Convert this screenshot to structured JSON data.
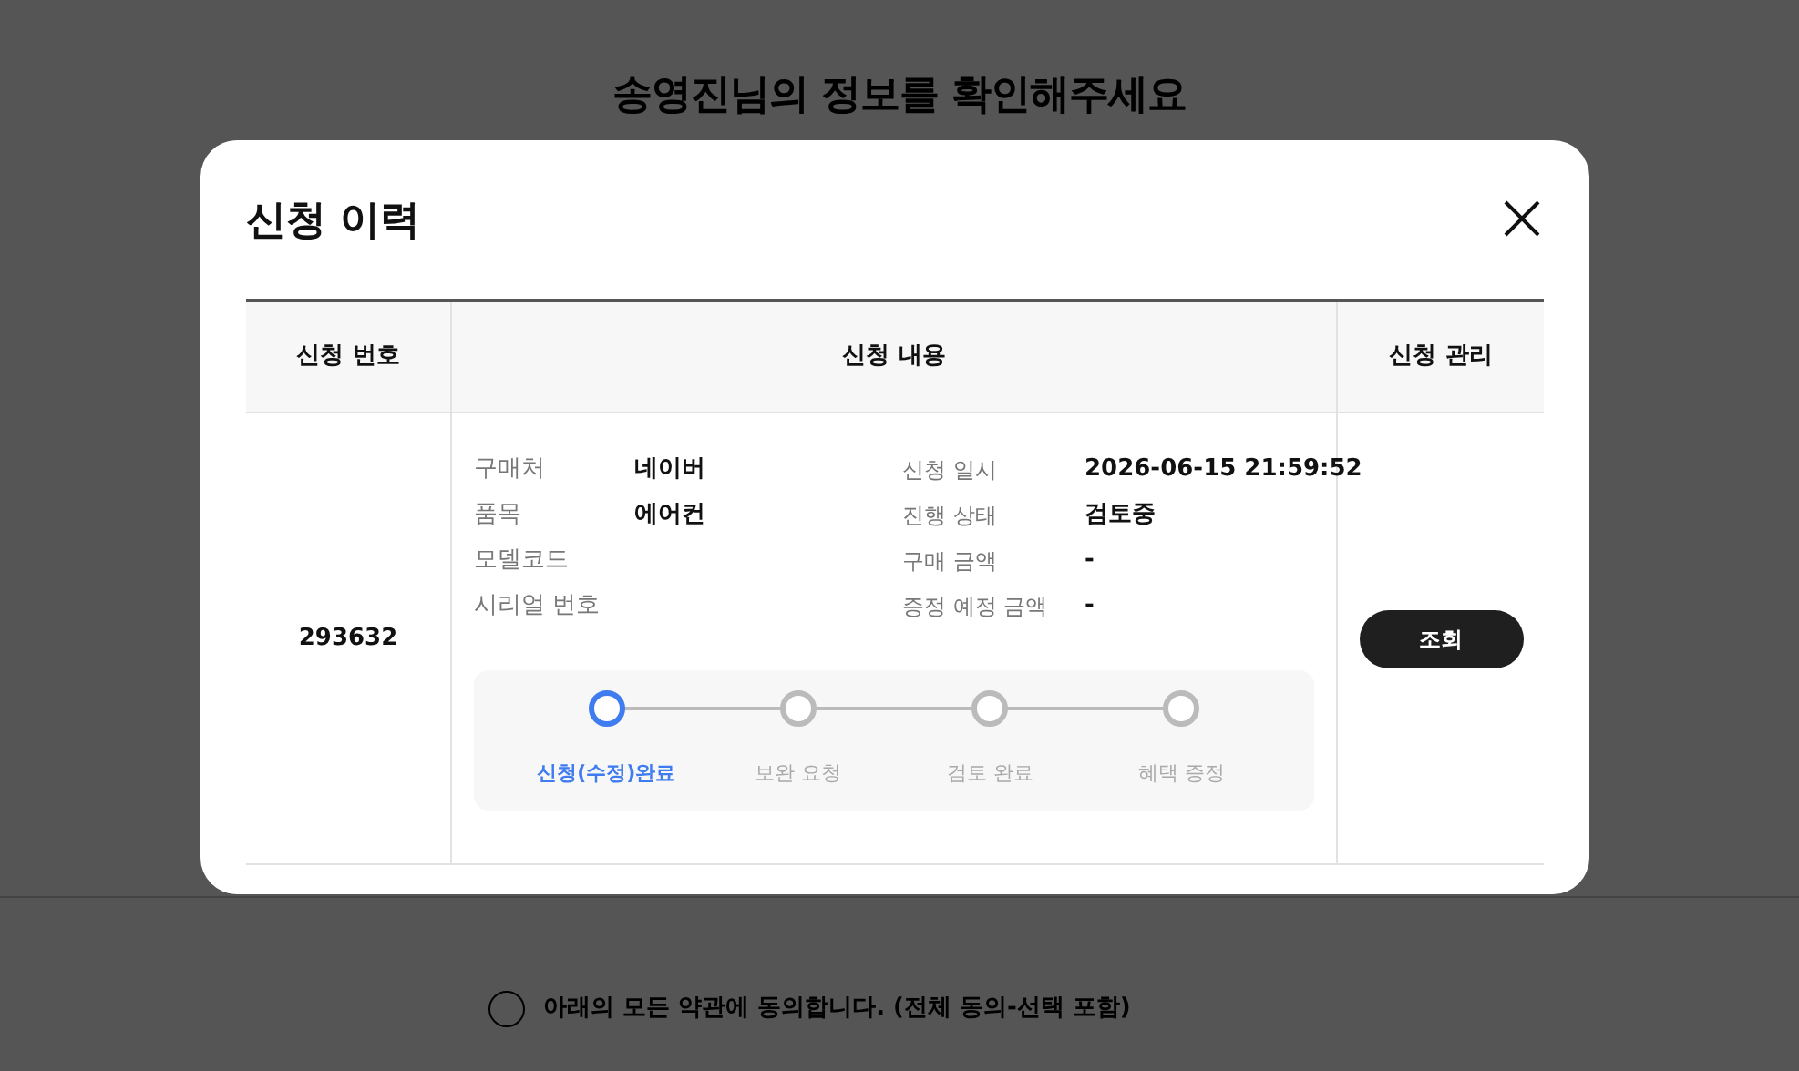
{
  "page_title": "송영진님의 정보를 확인해주세요",
  "modal": {
    "title": "신청 이력",
    "table": {
      "columns": [
        "신청 번호",
        "신청 내용",
        "신청 관리"
      ],
      "rows": [
        {
          "number": "293632",
          "details_left": [
            {
              "label": "구매처",
              "value": "네이버"
            },
            {
              "label": "품목",
              "value": "에어컨"
            },
            {
              "label": "모델코드"
            },
            {
              "label": "시리얼 번호"
            }
          ],
          "details_right": [
            {
              "label": "신청 일시",
              "value": "2026-06-15 21:59:52"
            },
            {
              "label": "진행 상태",
              "value": "검토중"
            },
            {
              "label": "구매 금액",
              "value": "-"
            },
            {
              "label": "증정 예정 금액",
              "value": "-"
            }
          ],
          "steps": [
            {
              "label": "신청(수정)완료",
              "selected": true
            },
            {
              "label": "보완 요청",
              "selected": false
            },
            {
              "label": "검토 완료",
              "selected": false
            },
            {
              "label": "혜택 증정",
              "selected": false
            }
          ],
          "action": "조회"
        }
      ]
    }
  },
  "agreements": [
    {
      "label": "아래의 모든 약관에 동의합니다. (전체 동의-선택 포함)",
      "checked": false
    }
  ]
}
